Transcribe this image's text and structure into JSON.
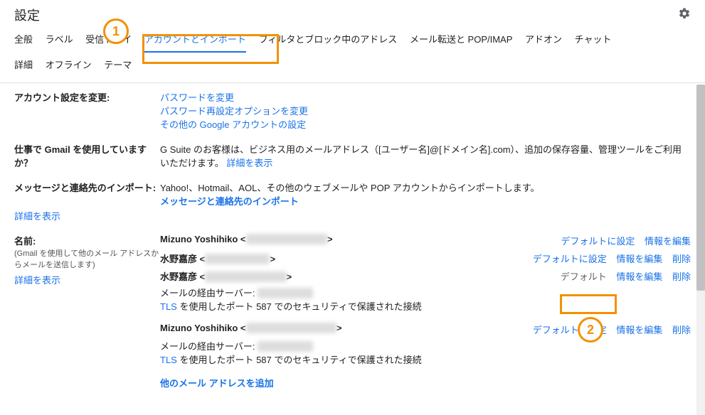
{
  "header": {
    "title": "設定"
  },
  "tabs": {
    "general": "全般",
    "labels": "ラベル",
    "inbox": "受信トレイ",
    "accounts": "アカウントとインポート",
    "filters": "フィルタとブロック中のアドレス",
    "forwarding": "メール転送と POP/IMAP",
    "addons": "アドオン",
    "chat": "チャット",
    "advanced": "詳細",
    "offline": "オフライン",
    "themes": "テーマ"
  },
  "account_change": {
    "label": "アカウント設定を変更:",
    "change_password": "パスワードを変更",
    "change_recovery": "パスワード再設定オプションを変更",
    "other_google": "その他の Google アカウントの設定"
  },
  "gsuite": {
    "label": "仕事で Gmail を使用していますか？",
    "text_before": "G Suite のお客様は、ビジネス用のメールアドレス（[ユーザー名]@[ドメイン名].com）、追加の保存容量、管理ツールをご利用いただけます。",
    "link": "詳細を表示"
  },
  "import": {
    "label": "メッセージと連絡先のインポート:",
    "desc": "Yahoo!、Hotmail、AOL、その他のウェブメールや POP アカウントからインポートします。",
    "action": "メッセージと連絡先のインポート",
    "more": "詳細を表示"
  },
  "sendas": {
    "label": "名前:",
    "sublabel": "(Gmail を使用して他のメール アドレスからメールを送信します)",
    "more": "詳細を表示",
    "entries": [
      {
        "name": "Mizuno Yoshihiko",
        "email_mask": "xxxxxx@xxxxxx.xxx",
        "set_default": "デフォルトに設定",
        "edit": "情報を編集",
        "delete": "",
        "is_default": false,
        "details": []
      },
      {
        "name": "水野嘉彦",
        "email_mask": "xxxxxx@xxxxxx",
        "set_default": "デフォルトに設定",
        "edit": "情報を編集",
        "delete": "削除",
        "is_default": false,
        "details": []
      },
      {
        "name": "水野嘉彦",
        "email_mask": "xxxxxx@xxxxxx.xxx",
        "set_default": "",
        "default_text": "デフォルト",
        "edit": "情報を編集",
        "delete": "削除",
        "is_default": true,
        "details": [
          {
            "label": "メールの経由サーバー: ",
            "mask": "xxxxxxxxxxxx"
          },
          {
            "tls": "TLS を使用したポート 587 でのセキュリティで保護された接続"
          }
        ]
      },
      {
        "name": "Mizuno Yoshihiko",
        "email_mask": "xxxxxx@xxxxxxxx.xxx",
        "set_default": "デフォルトに設定",
        "edit": "情報を編集",
        "delete": "削除",
        "is_default": false,
        "details": [
          {
            "label": "メールの経由サーバー: ",
            "mask": "xxxxxxxxxxxx"
          },
          {
            "tls": "TLS を使用したポート 587 でのセキュリティで保護された接続"
          }
        ]
      }
    ],
    "add_another": "他のメール アドレスを追加"
  },
  "annotations": {
    "n1": "1",
    "n2": "2"
  }
}
